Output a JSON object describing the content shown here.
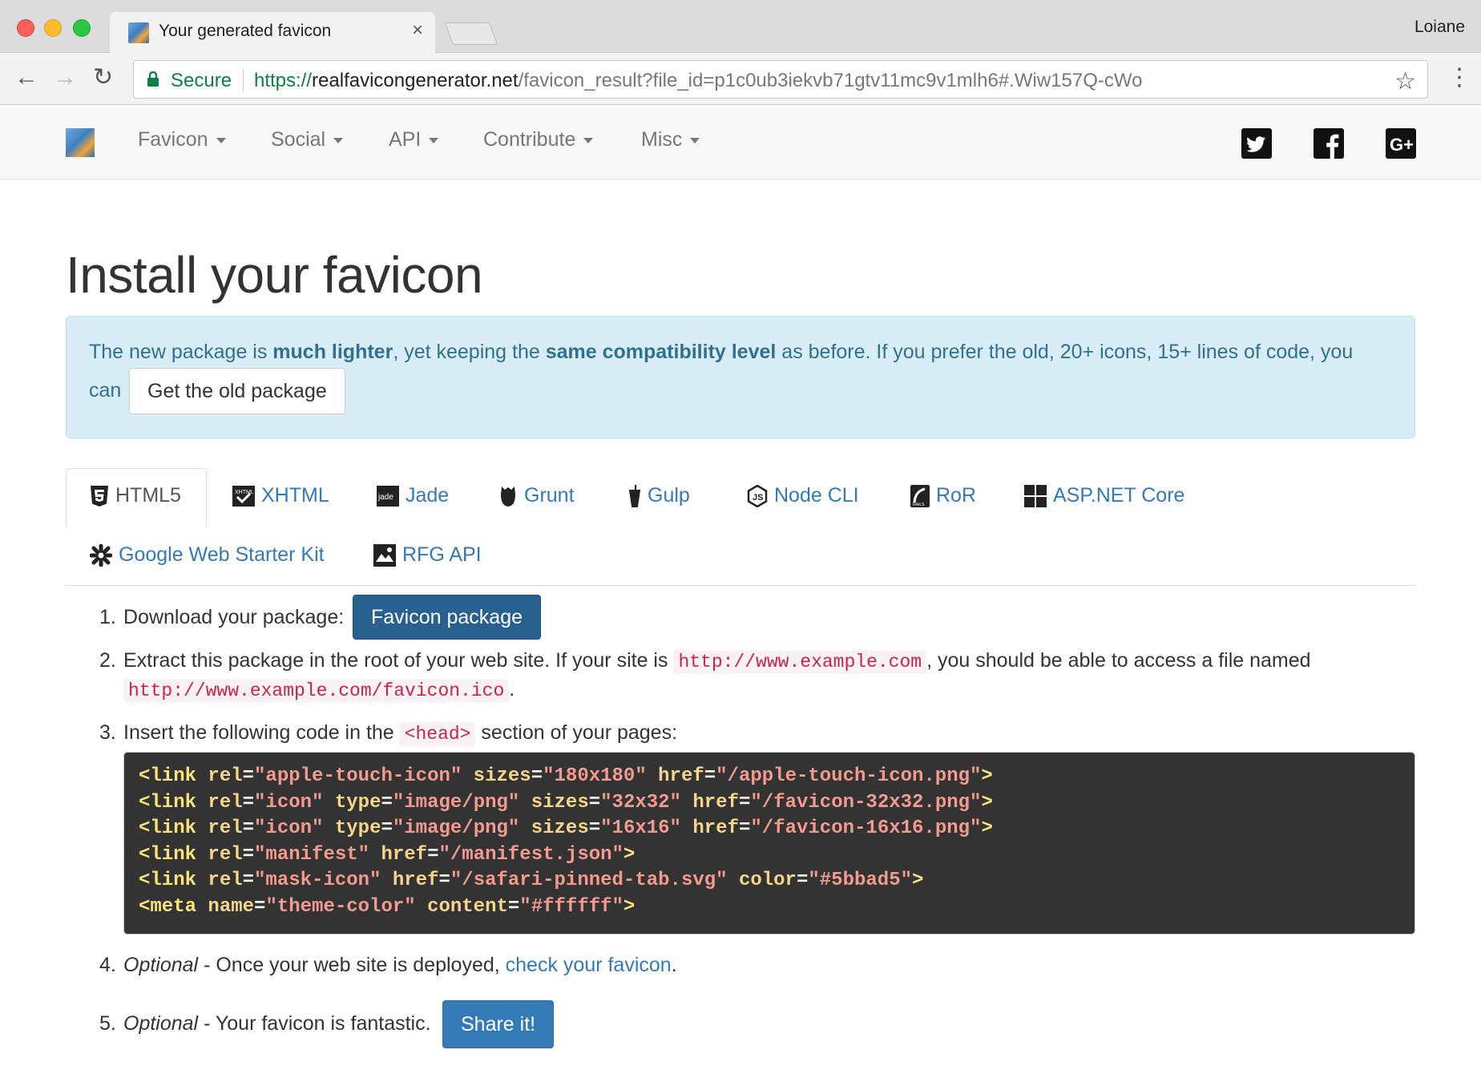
{
  "browser": {
    "tab_title": "Your generated favicon",
    "tab_close": "×",
    "profile_name": "Loiane",
    "secure_label": "Secure",
    "url_scheme": "https://",
    "url_host": "realfavicongenerator.net",
    "url_path": "/favicon_result?file_id=p1c0ub3iekvb71gtv11mc9v1mlh6#.Wiw157Q-cWo"
  },
  "navbar": {
    "items": [
      {
        "label": "Favicon"
      },
      {
        "label": "Social"
      },
      {
        "label": "API"
      },
      {
        "label": "Contribute"
      },
      {
        "label": "Misc"
      }
    ],
    "social_icons": [
      "twitter-icon",
      "facebook-icon",
      "google-plus-icon"
    ]
  },
  "page": {
    "title": "Install your favicon",
    "alert": {
      "t1": "The new package is ",
      "b1": "much lighter",
      "t2": ", yet keeping the ",
      "b2": "same compatibility level",
      "t3": " as before. If you prefer the old, 20+ icons, 15+ lines of code, you",
      "t4": "can",
      "button": "Get the old package"
    },
    "tabs": [
      {
        "label": "HTML5",
        "icon": "html5-icon"
      },
      {
        "label": "XHTML",
        "icon": "xhtml-icon"
      },
      {
        "label": "Jade",
        "icon": "jade-icon"
      },
      {
        "label": "Grunt",
        "icon": "grunt-icon"
      },
      {
        "label": "Gulp",
        "icon": "gulp-icon"
      },
      {
        "label": "Node CLI",
        "icon": "nodejs-icon"
      },
      {
        "label": "RoR",
        "icon": "rails-icon"
      },
      {
        "label": "ASP.NET Core",
        "icon": "windows-icon"
      },
      {
        "label": "Google Web Starter Kit",
        "icon": "starter-kit-icon"
      },
      {
        "label": "RFG API",
        "icon": "rfg-api-icon"
      }
    ],
    "steps": {
      "s1_num": "1.",
      "s1_text": "Download your package:",
      "s1_button": "Favicon package",
      "s2_num": "2.",
      "s2_text_a": "Extract this package in the root of your web site. If your site is ",
      "s2_code_a": "http://www.example.com",
      "s2_text_b": ", you should be able to access a file named",
      "s2_code_b": "http://www.example.com/favicon.ico",
      "s2_text_c": ".",
      "s3_num": "3.",
      "s3_text_a": "Insert the following code in the ",
      "s3_code": "<head>",
      "s3_text_b": " section of your pages:",
      "s4_num": "4.",
      "s4_em": "Optional",
      "s4_text": " - Once your web site is deployed, ",
      "s4_link": "check your favicon",
      "s4_text_b": ".",
      "s5_num": "5.",
      "s5_em": "Optional",
      "s5_text": " - Your favicon is fantastic.",
      "s5_button": "Share it!"
    },
    "code_lines": [
      [
        [
          "tg",
          "<link"
        ],
        [
          "at",
          " rel"
        ],
        [
          "eq",
          "="
        ],
        [
          "st",
          "\"apple-touch-icon\""
        ],
        [
          "at",
          " sizes"
        ],
        [
          "eq",
          "="
        ],
        [
          "st",
          "\"180x180\""
        ],
        [
          "at",
          " href"
        ],
        [
          "eq",
          "="
        ],
        [
          "st",
          "\"/apple-touch-icon.png\""
        ],
        [
          "tg",
          ">"
        ]
      ],
      [
        [
          "tg",
          "<link"
        ],
        [
          "at",
          " rel"
        ],
        [
          "eq",
          "="
        ],
        [
          "st",
          "\"icon\""
        ],
        [
          "at",
          " type"
        ],
        [
          "eq",
          "="
        ],
        [
          "st",
          "\"image/png\""
        ],
        [
          "at",
          " sizes"
        ],
        [
          "eq",
          "="
        ],
        [
          "st",
          "\"32x32\""
        ],
        [
          "at",
          " href"
        ],
        [
          "eq",
          "="
        ],
        [
          "st",
          "\"/favicon-32x32.png\""
        ],
        [
          "tg",
          ">"
        ]
      ],
      [
        [
          "tg",
          "<link"
        ],
        [
          "at",
          " rel"
        ],
        [
          "eq",
          "="
        ],
        [
          "st",
          "\"icon\""
        ],
        [
          "at",
          " type"
        ],
        [
          "eq",
          "="
        ],
        [
          "st",
          "\"image/png\""
        ],
        [
          "at",
          " sizes"
        ],
        [
          "eq",
          "="
        ],
        [
          "st",
          "\"16x16\""
        ],
        [
          "at",
          " href"
        ],
        [
          "eq",
          "="
        ],
        [
          "st",
          "\"/favicon-16x16.png\""
        ],
        [
          "tg",
          ">"
        ]
      ],
      [
        [
          "tg",
          "<link"
        ],
        [
          "at",
          " rel"
        ],
        [
          "eq",
          "="
        ],
        [
          "st",
          "\"manifest\""
        ],
        [
          "at",
          " href"
        ],
        [
          "eq",
          "="
        ],
        [
          "st",
          "\"/manifest.json\""
        ],
        [
          "tg",
          ">"
        ]
      ],
      [
        [
          "tg",
          "<link"
        ],
        [
          "at",
          " rel"
        ],
        [
          "eq",
          "="
        ],
        [
          "st",
          "\"mask-icon\""
        ],
        [
          "at",
          " href"
        ],
        [
          "eq",
          "="
        ],
        [
          "st",
          "\"/safari-pinned-tab.svg\""
        ],
        [
          "at",
          " color"
        ],
        [
          "eq",
          "="
        ],
        [
          "st",
          "\"#5bbad5\""
        ],
        [
          "tg",
          ">"
        ]
      ],
      [
        [
          "tg",
          "<meta"
        ],
        [
          "at",
          " name"
        ],
        [
          "eq",
          "="
        ],
        [
          "st",
          "\"theme-color\""
        ],
        [
          "at",
          " content"
        ],
        [
          "eq",
          "="
        ],
        [
          "st",
          "\"#ffffff\""
        ],
        [
          "tg",
          ">"
        ]
      ]
    ],
    "colors": {
      "link": "#337ab7",
      "alert_bg": "#d9edf7",
      "alert_text": "#31708f",
      "code_bg": "#333333",
      "inline_code": "#c7254e"
    }
  }
}
